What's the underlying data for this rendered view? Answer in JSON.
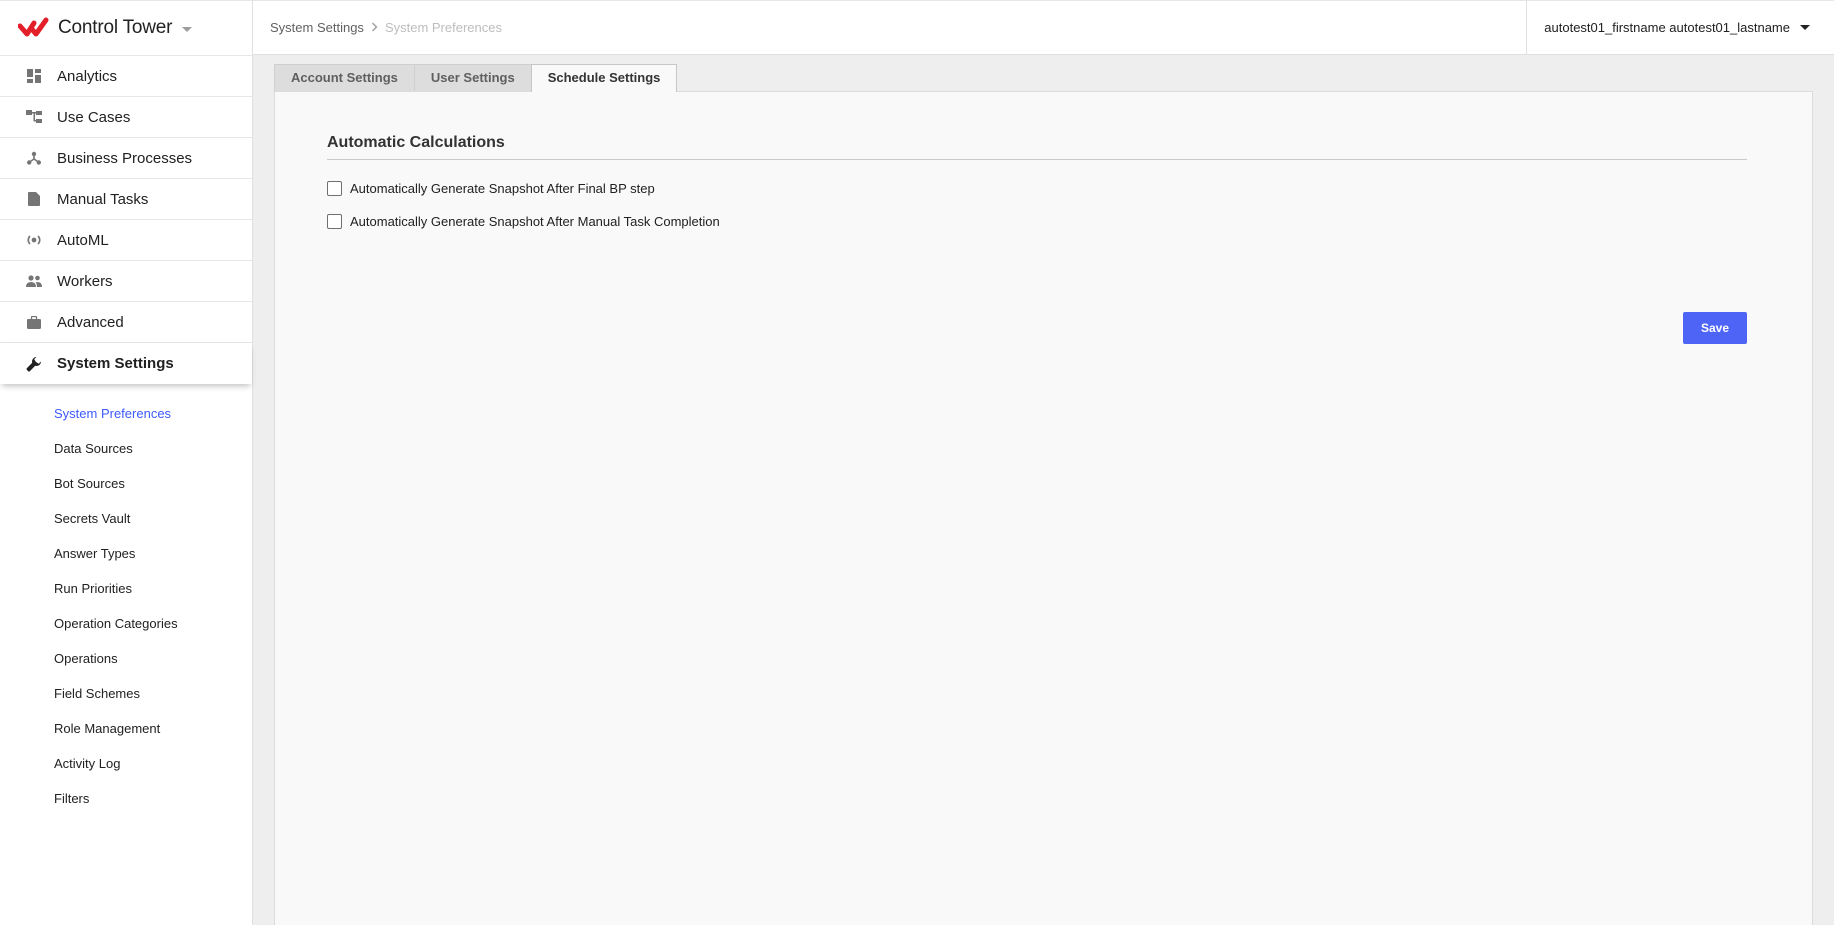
{
  "brand": {
    "name": "Control Tower",
    "accent": "#e3202a"
  },
  "sidebar": {
    "items": [
      {
        "label": "Analytics",
        "icon": "dashboard-icon"
      },
      {
        "label": "Use Cases",
        "icon": "hierarchy-icon"
      },
      {
        "label": "Business Processes",
        "icon": "process-icon"
      },
      {
        "label": "Manual Tasks",
        "icon": "document-icon"
      },
      {
        "label": "AutoML",
        "icon": "automl-icon"
      },
      {
        "label": "Workers",
        "icon": "people-icon"
      },
      {
        "label": "Advanced",
        "icon": "briefcase-icon"
      },
      {
        "label": "System Settings",
        "icon": "wrench-icon",
        "active": true
      }
    ],
    "subitems": [
      {
        "label": "System Preferences",
        "active": true
      },
      {
        "label": "Data Sources"
      },
      {
        "label": "Bot Sources"
      },
      {
        "label": "Secrets Vault"
      },
      {
        "label": "Answer Types"
      },
      {
        "label": "Run Priorities"
      },
      {
        "label": "Operation Categories"
      },
      {
        "label": "Operations"
      },
      {
        "label": "Field Schemes"
      },
      {
        "label": "Role Management"
      },
      {
        "label": "Activity Log"
      },
      {
        "label": "Filters"
      }
    ]
  },
  "header": {
    "breadcrumb": [
      "System Settings",
      "System Preferences"
    ],
    "user": "autotest01_firstname autotest01_lastname"
  },
  "main": {
    "tabs": [
      {
        "label": "Account Settings"
      },
      {
        "label": "User Settings"
      },
      {
        "label": "Schedule Settings",
        "active": true
      }
    ],
    "section_title": "Automatic Calculations",
    "checkboxes": [
      {
        "label": "Automatically Generate Snapshot After Final BP step",
        "checked": false
      },
      {
        "label": "Automatically Generate Snapshot After Manual Task Completion",
        "checked": false
      }
    ],
    "save_label": "Save"
  },
  "colors": {
    "link_active": "#3d5afe",
    "save_button": "#4e64f7",
    "content_bg": "#f9f9f9",
    "page_bg": "#eeeeef"
  }
}
